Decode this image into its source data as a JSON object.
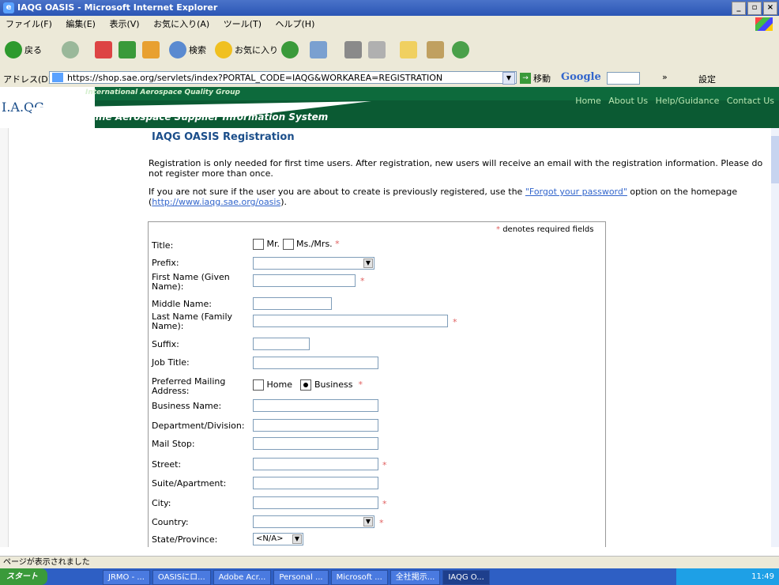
{
  "window": {
    "title": "IAQG OASIS - Microsoft Internet Explorer"
  },
  "menu": [
    "ファイル(F)",
    "編集(E)",
    "表示(V)",
    "お気に入り(A)",
    "ツール(T)",
    "ヘルプ(H)"
  ],
  "toolbar": {
    "back": "戻る",
    "search": "検索",
    "favorites": "お気に入り"
  },
  "address": {
    "label": "アドレス(D)",
    "url": "https://shop.sae.org/servlets/index?PORTAL_CODE=IAQG&WORKAREA=REGISTRATION",
    "go": "移動",
    "google": "Google",
    "settings": "設定"
  },
  "banner": {
    "logo": "I.A.QG.",
    "org": "International Aerospace Quality Group",
    "system": "Online Aerospace Supplier Information System",
    "nav": [
      "Home",
      "About Us",
      "Help/Guidance",
      "Contact Us"
    ]
  },
  "page": {
    "heading": "IAQG OASIS Registration",
    "intro1": "Registration is only needed for first time users. After registration, new users will receive an email with the registration information. Please do not register more than once.",
    "intro2_pre": "If you are not sure if the user you are about to create is previously registered, use the ",
    "intro2_link": "\"Forgot your password\"",
    "intro2_mid": " option on the homepage (",
    "intro2_url": "http://www.iaqg.sae.org/oasis",
    "intro2_post": ")."
  },
  "form": {
    "required_note": "denotes required fields",
    "title_label": "Title:",
    "title_options": [
      "Mr.",
      "Ms./Mrs."
    ],
    "prefix_label": "Prefix:",
    "first_name_label": "First Name (Given Name):",
    "middle_name_label": "Middle Name:",
    "last_name_label": "Last Name (Family Name):",
    "suffix_label": "Suffix:",
    "job_title_label": "Job Title:",
    "preferred_label": "Preferred Mailing Address:",
    "preferred_options": [
      "Home",
      "Business"
    ],
    "business_name_label": "Business Name:",
    "department_label": "Department/Division:",
    "mail_stop_label": "Mail Stop:",
    "street_label": "Street:",
    "suite_label": "Suite/Apartment:",
    "city_label": "City:",
    "country_label": "Country:",
    "state_label": "State/Province:",
    "state_value": "<N/A>"
  },
  "status": {
    "text": "ページが表示されました"
  },
  "taskbar": {
    "start": "スタート",
    "tasks": [
      "JRMO - ...",
      "OASISにロ...",
      "Adobe Acr...",
      "Personal ...",
      "Microsoft ...",
      "全社掲示...",
      "IAQG O..."
    ],
    "clock": "11:49"
  }
}
